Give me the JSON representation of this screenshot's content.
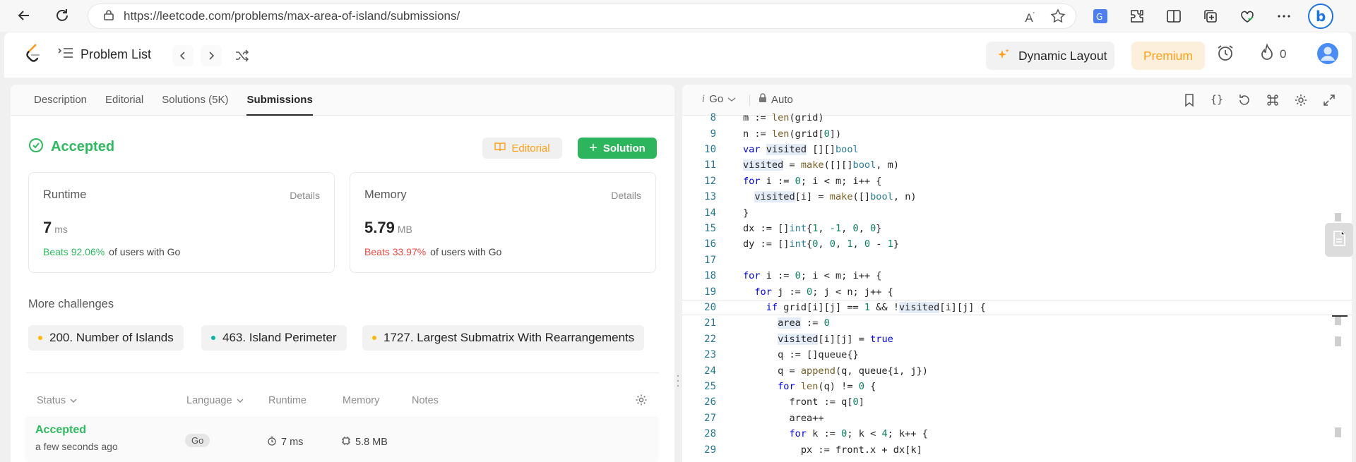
{
  "browser": {
    "url": "https://leetcode.com/problems/max-area-of-island/submissions/"
  },
  "header": {
    "problem_list": "Problem List",
    "dynamic_layout": "Dynamic Layout",
    "premium": "Premium",
    "streak_count": "0"
  },
  "tabs": [
    "Description",
    "Editorial",
    "Solutions (5K)",
    "Submissions"
  ],
  "result": {
    "status": "Accepted",
    "editorial_btn": "Editorial",
    "solution_btn": "Solution"
  },
  "runtime": {
    "title": "Runtime",
    "details": "Details",
    "value": "7",
    "unit": "ms",
    "beats": "Beats 92.06%",
    "beats_rest": "of users with Go"
  },
  "memory": {
    "title": "Memory",
    "details": "Details",
    "value": "5.79",
    "unit": "MB",
    "beats": "Beats 33.97%",
    "beats_rest": "of users with Go"
  },
  "more": {
    "title": "More challenges",
    "challenges": [
      {
        "label": "200. Number of Islands",
        "color": "#ffb800"
      },
      {
        "label": "463. Island Perimeter",
        "color": "#00b8a3"
      },
      {
        "label": "1727. Largest Submatrix With Rearrangements",
        "color": "#ffb800"
      }
    ]
  },
  "table": {
    "headers": {
      "status": "Status",
      "language": "Language",
      "runtime": "Runtime",
      "memory": "Memory",
      "notes": "Notes"
    },
    "rows": [
      {
        "status": "Accepted",
        "time": "a few seconds ago",
        "language": "Go",
        "runtime": "7 ms",
        "memory": "5.8 MB"
      }
    ]
  },
  "editor": {
    "language": "Go",
    "mode": "Auto",
    "lines": [
      {
        "n": "8",
        "html": "m := <span class='fn'>len</span>(grid)"
      },
      {
        "n": "9",
        "html": "n := <span class='fn'>len</span>(grid[<span class='nm'>0</span>])"
      },
      {
        "n": "10",
        "html": "<span class='kw'>var</span> <span class='vh'>visited</span> [][]<span class='ty'>bool</span>"
      },
      {
        "n": "11",
        "html": "<span class='vh'>visited</span> = <span class='fn'>make</span>([][]<span class='ty'>bool</span>, m)"
      },
      {
        "n": "12",
        "html": "<span class='kw'>for</span> i := <span class='nm'>0</span>; i &lt; m; i++ {"
      },
      {
        "n": "13",
        "html": "  <span class='vh'>visited</span>[i] = <span class='fn'>make</span>([]<span class='ty'>bool</span>, n)"
      },
      {
        "n": "14",
        "html": "}"
      },
      {
        "n": "15",
        "html": "dx := []<span class='ty'>int</span>{<span class='nm'>1</span>, <span class='nm'>-1</span>, <span class='nm'>0</span>, <span class='nm'>0</span>}"
      },
      {
        "n": "16",
        "html": "dy := []<span class='ty'>int</span>{<span class='nm'>0</span>, <span class='nm'>0</span>, <span class='nm'>1</span>, <span class='nm'>0</span> - <span class='nm'>1</span>}"
      },
      {
        "n": "17",
        "html": ""
      },
      {
        "n": "18",
        "html": "<span class='kw'>for</span> i := <span class='nm'>0</span>; i &lt; m; i++ {"
      },
      {
        "n": "19",
        "html": "  <span class='kw'>for</span> j := <span class='nm'>0</span>; j &lt; n; j++ {"
      },
      {
        "n": "20",
        "html": "    <span class='kw'>if</span> grid[i][j] == <span class='nm'>1</span> &amp;&amp; !<span class='vh'>visited</span>[i][j] {"
      },
      {
        "n": "21",
        "html": "      <span class='vh'>area</span> := <span class='nm'>0</span>"
      },
      {
        "n": "22",
        "html": "      <span class='vh'>visited</span>[i][j] = <span class='kw'>true</span>"
      },
      {
        "n": "23",
        "html": "      q := []queue{}"
      },
      {
        "n": "24",
        "html": "      q = <span class='fn'>append</span>(q, queue{i, j})"
      },
      {
        "n": "25",
        "html": "      <span class='kw'>for</span> <span class='fn'>len</span>(q) != <span class='nm'>0</span> {"
      },
      {
        "n": "26",
        "html": "        front := q[<span class='nm'>0</span>]"
      },
      {
        "n": "27",
        "html": "        area++"
      },
      {
        "n": "28",
        "html": "        <span class='kw'>for</span> k := <span class='nm'>0</span>; k &lt; <span class='nm'>4</span>; k++ {"
      },
      {
        "n": "29",
        "html": "          px := front.x + dx[k]"
      }
    ]
  }
}
